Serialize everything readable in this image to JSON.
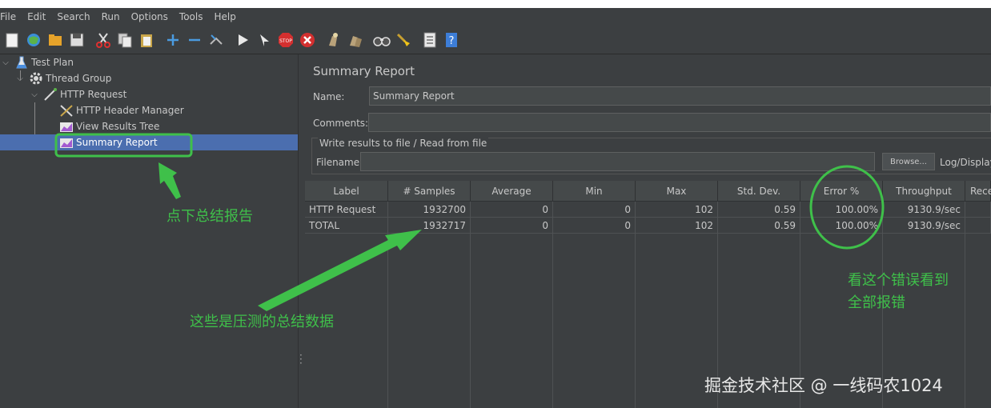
{
  "menu": [
    "File",
    "Edit",
    "Search",
    "Run",
    "Options",
    "Tools",
    "Help"
  ],
  "toolbar_icons": [
    "new-icon",
    "templates-icon",
    "open-icon",
    "save-icon",
    "cut-icon",
    "copy-icon",
    "paste-icon",
    "expand-icon",
    "collapse-icon",
    "toggle-icon",
    "start-icon",
    "start-no-pause-icon",
    "stop-icon",
    "shutdown-icon",
    "clear-icon",
    "clear-all-icon",
    "search-icon",
    "reset-search-icon",
    "function-helper-icon",
    "help-icon"
  ],
  "tree": {
    "test_plan": "Test Plan",
    "thread_group": "Thread Group",
    "http_request": "HTTP Request",
    "header_manager": "HTTP Header Manager",
    "view_results_tree": "View Results Tree",
    "summary_report": "Summary Report"
  },
  "report": {
    "title": "Summary Report",
    "name_label": "Name:",
    "name_value": "Summary Report",
    "comments_label": "Comments:",
    "comments_value": "",
    "file_group_title": "Write results to file / Read from file",
    "filename_label": "Filename",
    "filename_value": "",
    "browse_label": "Browse...",
    "log_display_label": "Log/Display"
  },
  "table": {
    "headers": [
      "Label",
      "# Samples",
      "Average",
      "Min",
      "Max",
      "Std. Dev.",
      "Error %",
      "Throughput",
      "Rece"
    ],
    "rows": [
      [
        "HTTP Request",
        "1932700",
        "0",
        "0",
        "102",
        "0.59",
        "100.00%",
        "9130.9/sec",
        ""
      ],
      [
        "TOTAL",
        "1932717",
        "0",
        "0",
        "102",
        "0.59",
        "100.00%",
        "9130.9/sec",
        ""
      ]
    ]
  },
  "annotations": {
    "click_summary": "点下总结报告",
    "summary_data": "这些是压测的总结数据",
    "error_line1": "看这个错误看到",
    "error_line2": "全部报错",
    "watermark": "掘金技术社区 @ 一线码农1024"
  },
  "colors": {
    "annotation_green": "#3fc04a",
    "selection_blue": "#4b6eaf",
    "background": "#3c3f41"
  }
}
